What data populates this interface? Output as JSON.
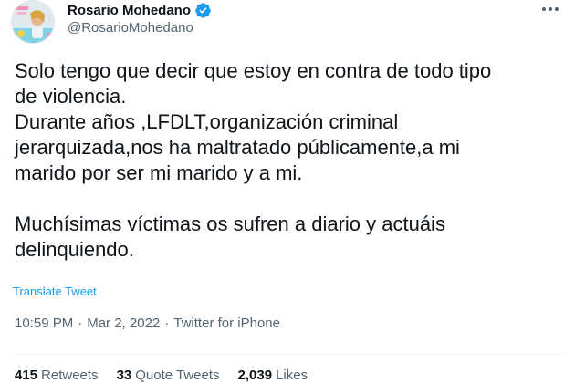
{
  "author": {
    "display_name": "Rosario Mohedano",
    "handle": "@RosarioMohedano",
    "verified": true,
    "verified_color": "#1d9bf0"
  },
  "tweet": {
    "text": "Solo tengo que decir que estoy en contra de todo tipo\nde violencia.\nDurante años ,LFDLT,organización criminal\njerarquizada,nos ha maltratado públicamente,a mi\nmarido por ser mi marido y a mi.\n\nMuchísimas víctimas os sufren a diario y actuáis\ndelinquiendo.",
    "translate_label": "Translate Tweet",
    "time": "10:59 PM",
    "date": "Mar 2, 2022",
    "source": "Twitter for iPhone",
    "separator": "·"
  },
  "stats": {
    "retweets_count": "415",
    "retweets_label": "Retweets",
    "quotes_count": "33",
    "quotes_label": "Quote Tweets",
    "likes_count": "2,039",
    "likes_label": "Likes"
  },
  "icons": {
    "more": "more-options-icon",
    "verified": "verified-badge-icon"
  }
}
